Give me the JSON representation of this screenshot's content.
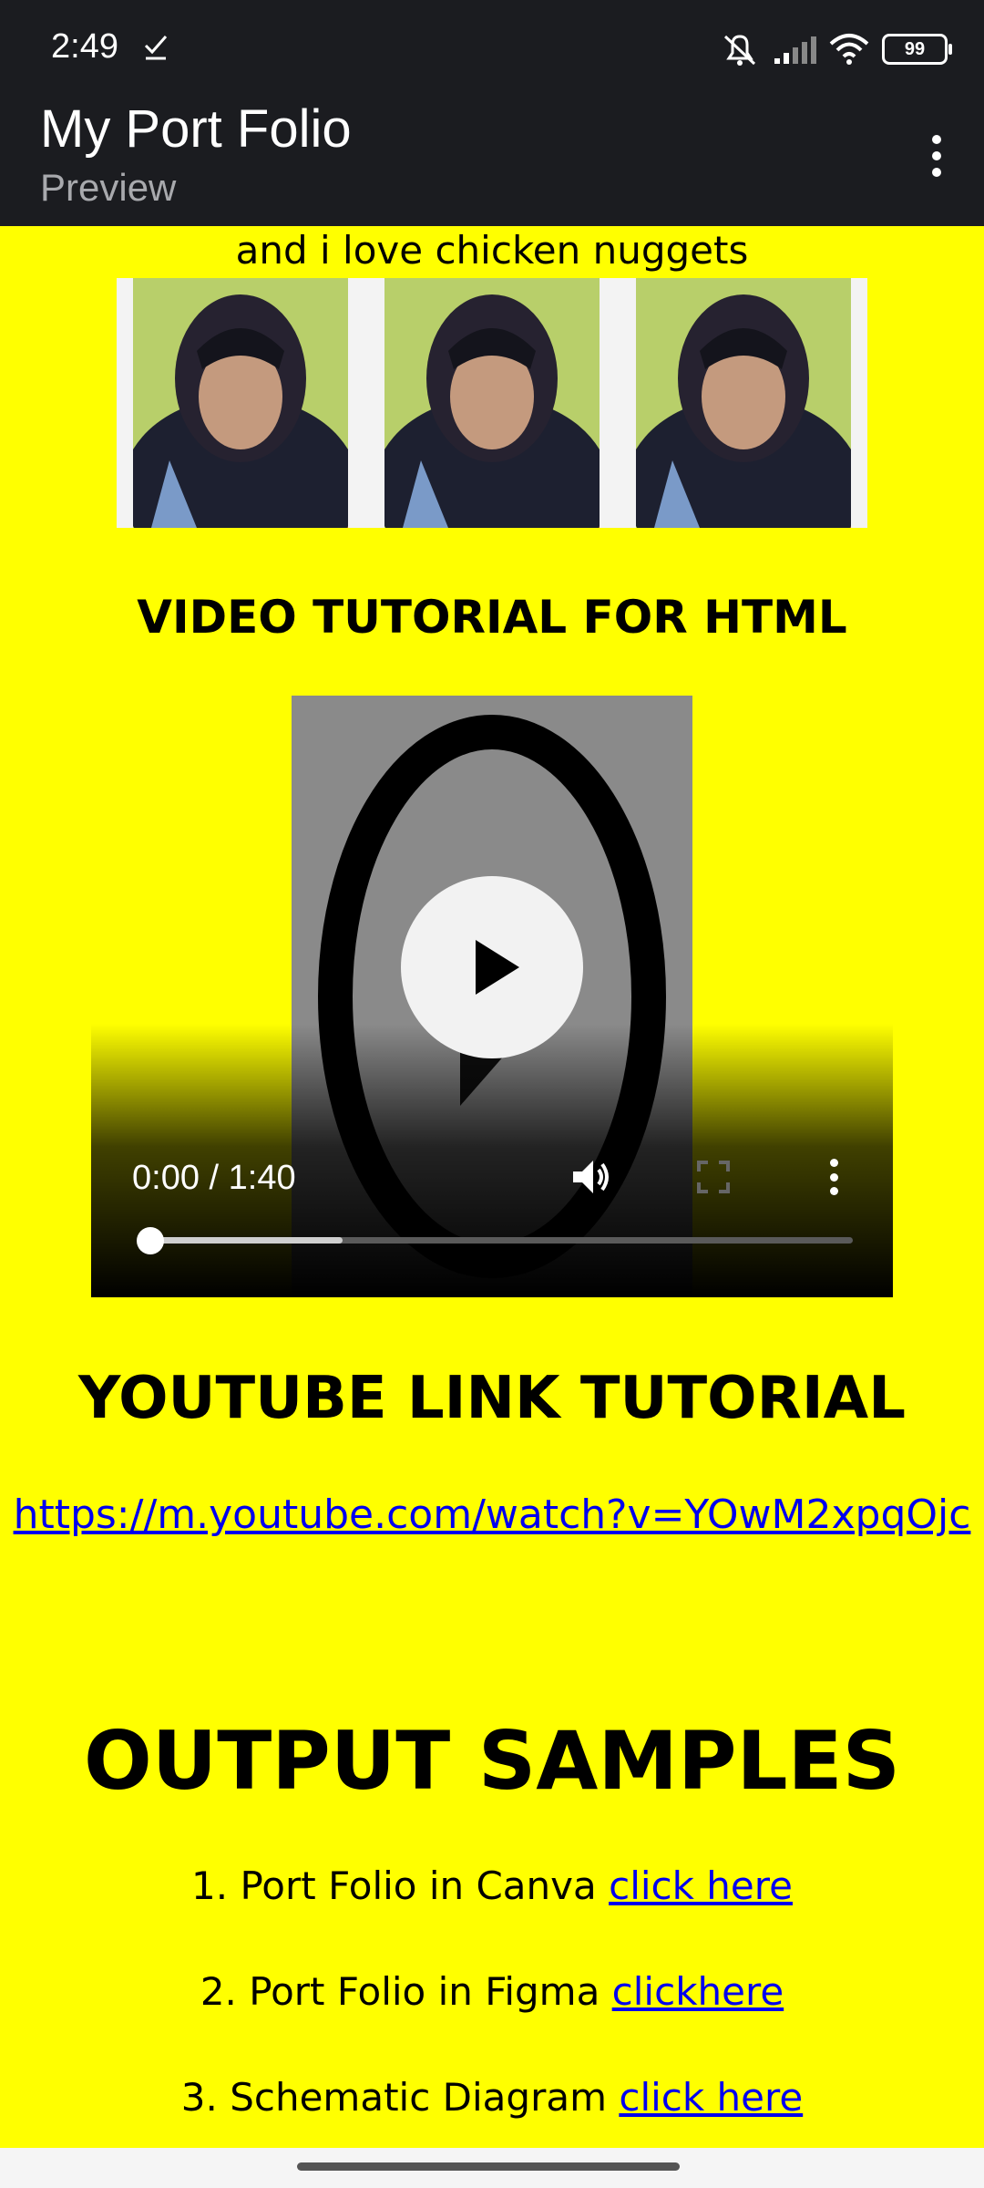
{
  "status_bar": {
    "time": "2:49",
    "battery": "99"
  },
  "app_bar": {
    "title": "My Port Folio",
    "subtitle": "Preview"
  },
  "tagline": "and i love chicken nuggets",
  "video_section": {
    "heading": "VIDEO TUTORIAL FOR HTML",
    "time_display": "0:00 / 1:40",
    "progress_fraction": 0.0,
    "buffered_fraction": 0.28
  },
  "youtube_section": {
    "heading": "YOUTUBE LINK TUTORIAL",
    "link": "https://m.youtube.com/watch?v=YOwM2xpqOjc"
  },
  "output_samples": {
    "heading": "OUTPUT SAMPLES",
    "items": [
      {
        "text": "1. Port Folio in Canva",
        "link": "click here"
      },
      {
        "text": "2. Port Folio in Figma",
        "link": "clickhere"
      },
      {
        "text": "3. Schematic Diagram",
        "link": "click here"
      }
    ]
  },
  "colors": {
    "page_bg": "#ffff00",
    "app_bar": "#1b1c20",
    "link": "#0000ee"
  },
  "icons": [
    "check-icon",
    "mute-bell-icon",
    "signal-icon",
    "wifi-icon",
    "battery-icon",
    "more-vert-icon",
    "play-icon",
    "volume-icon",
    "fullscreen-icon"
  ]
}
